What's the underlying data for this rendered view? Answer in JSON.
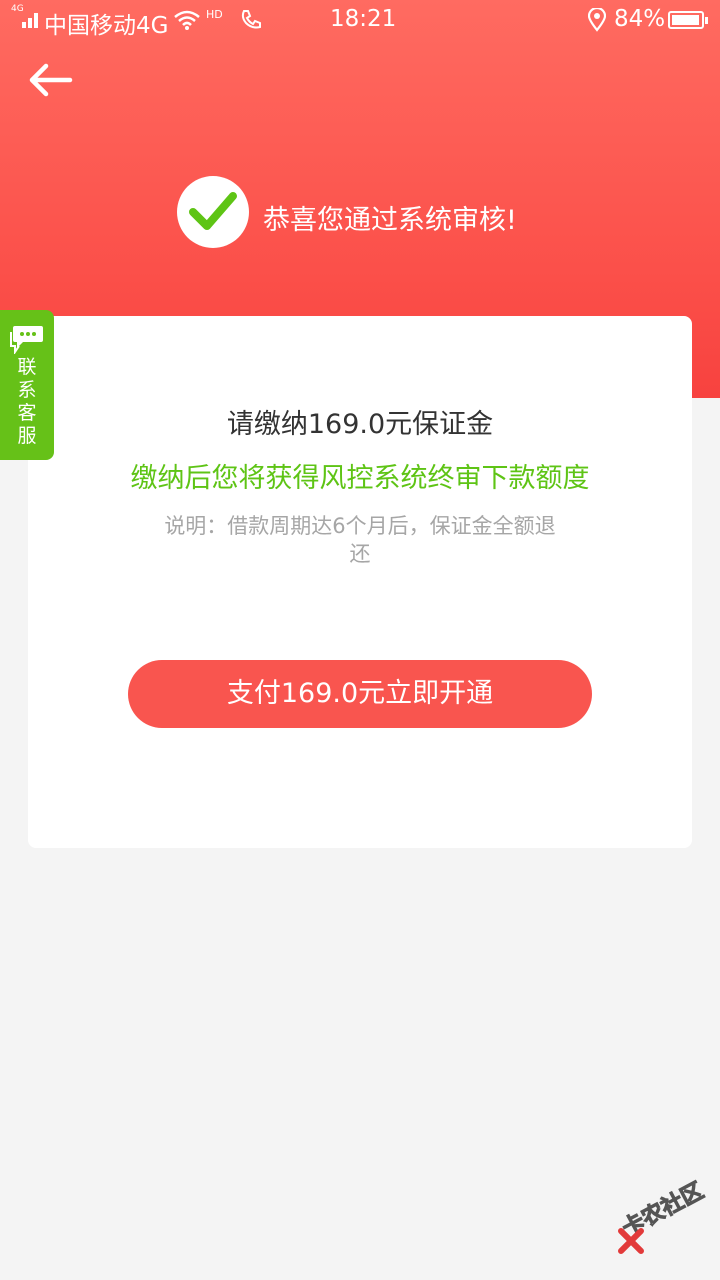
{
  "status_bar": {
    "network_badge": "4G",
    "carrier": "中国移动4G",
    "hd_label": "HD",
    "time": "18:21",
    "battery": "84%"
  },
  "header": {
    "success_message": "恭喜您通过系统审核!"
  },
  "card": {
    "deposit_text": "请缴纳169.0元保证金",
    "benefit_text": "缴纳后您将获得风控系统终审下款额度",
    "note_text": "说明：借款周期达6个月后，保证金全额退还",
    "pay_button_label": "支付169.0元立即开通"
  },
  "customer_service": {
    "label": "联系客服"
  },
  "watermark": {
    "text": "卡农社区"
  },
  "colors": {
    "header_red": "#fb4f49",
    "button_red": "#f9554f",
    "accent_green": "#5ec415",
    "cs_green": "#66c118"
  }
}
